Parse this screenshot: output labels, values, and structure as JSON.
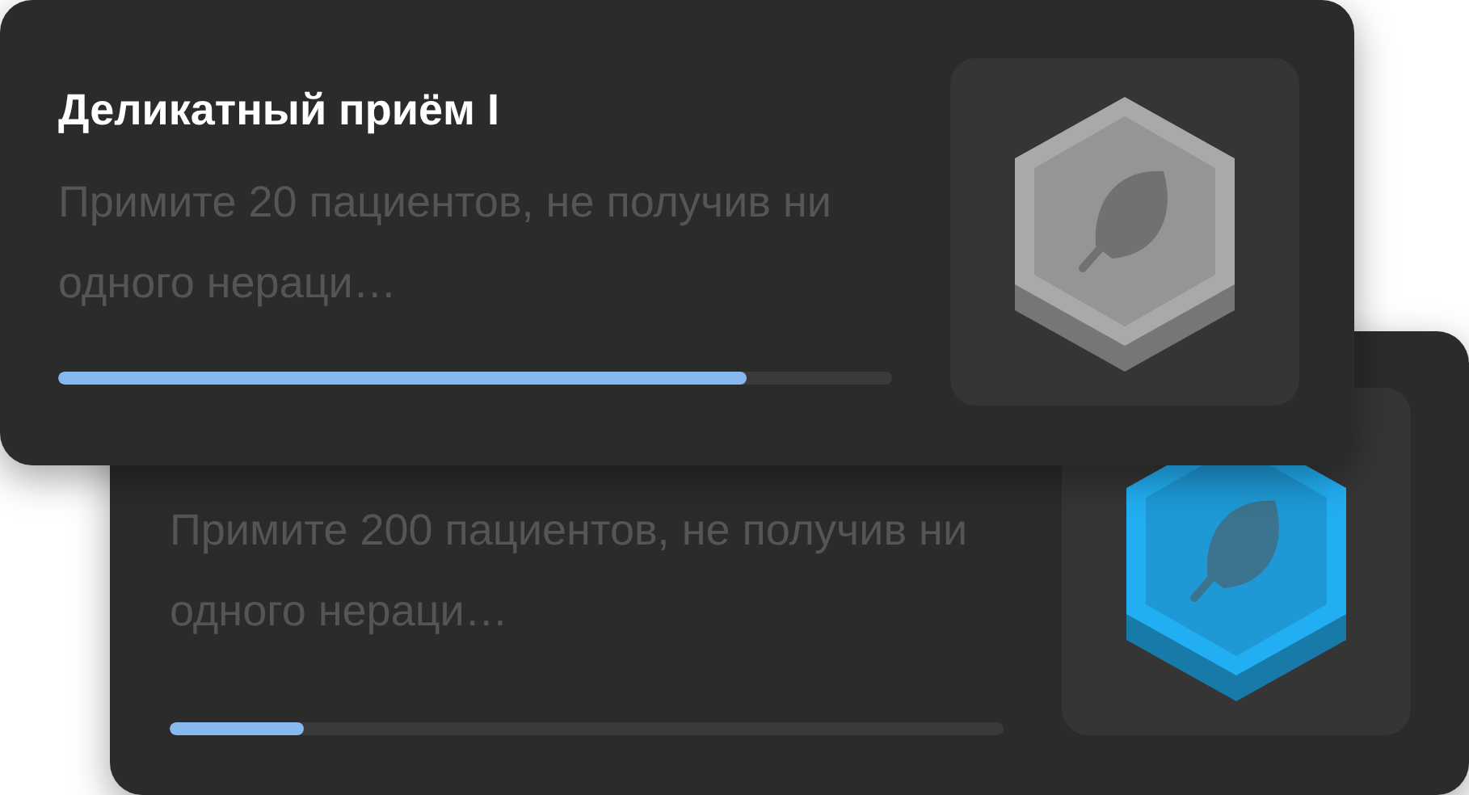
{
  "cards": [
    {
      "title": "Деликатный приём I",
      "description": "Примите 20 пациентов, не получив ни одного нераци…",
      "level": 0.825,
      "badge": {
        "color": "#a9a9a9"
      }
    },
    {
      "description": "Примите 200 пациентов, не получив ни одного нераци…",
      "level": 0.16,
      "badge": {
        "color": "#22aef2"
      }
    }
  ]
}
